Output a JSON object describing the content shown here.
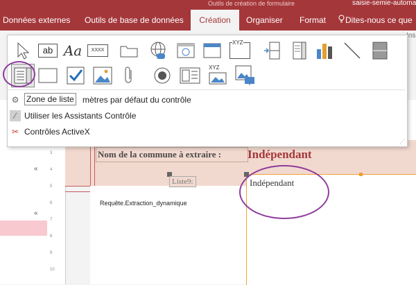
{
  "ribbon": {
    "context_title": "Outils de création de formulaire",
    "doc_title": "saisie-semie-automati",
    "tabs": [
      {
        "label": "Données externes"
      },
      {
        "label": "Outils de base de données"
      },
      {
        "label": "Création"
      },
      {
        "label": "Organiser"
      },
      {
        "label": "Format"
      },
      {
        "label": "Dites-nous ce que"
      }
    ],
    "group_label_partial": "Ins",
    "active_tab_color": "#a4373a"
  },
  "controls_gallery": {
    "row1": [
      "select-pointer-icon",
      "textbox-ab-icon",
      "label-aa-icon",
      "button-xxxx-icon",
      "tab-control-icon",
      "hyperlink-icon",
      "web-browser-icon",
      "navigation-icon",
      "option-group-xyz-icon",
      "page-break-icon",
      "combo-box-icon",
      "chart-icon",
      "line-icon",
      "toggle-icon"
    ],
    "row2": [
      "list-box-icon",
      "rectangle-icon",
      "checkbox-icon",
      "image-icon",
      "attachment-icon",
      "option-button-icon",
      "subform-icon",
      "object-frame-xyz-icon",
      "bound-object-icon"
    ],
    "aa_text": "Aa",
    "ab_text": "ab",
    "xxxx_text": "XXXX",
    "xyz_text": "XYZ",
    "tooltip": "Zone de liste",
    "menu": [
      {
        "label": "Définir les paramètres par défaut du contrôle",
        "visible_text": "mètres par défaut du contrôle",
        "icon": "defaults-icon"
      },
      {
        "label": "Utiliser les Assistants Contrôle",
        "icon": "wand-icon"
      },
      {
        "label": "Contrôles ActiveX",
        "icon": "activex-icon"
      }
    ]
  },
  "form": {
    "label_commune": "Nom de la commune à extraire :",
    "label_independant_big": "Indépendant",
    "label_liste": "Liste9:",
    "listbox_value": "Indépendant",
    "query_source": "Requête.Extraction_dynamique",
    "collapse_glyph": "«",
    "ruler_marks": [
      "3",
      "4",
      "5",
      "6",
      "7",
      "8",
      "9",
      "10"
    ]
  },
  "colors": {
    "accent": "#a4373a",
    "highlight_circle": "#8e3b9c",
    "selection_orange": "#f0a030",
    "section_band": "#f2d9cf"
  }
}
